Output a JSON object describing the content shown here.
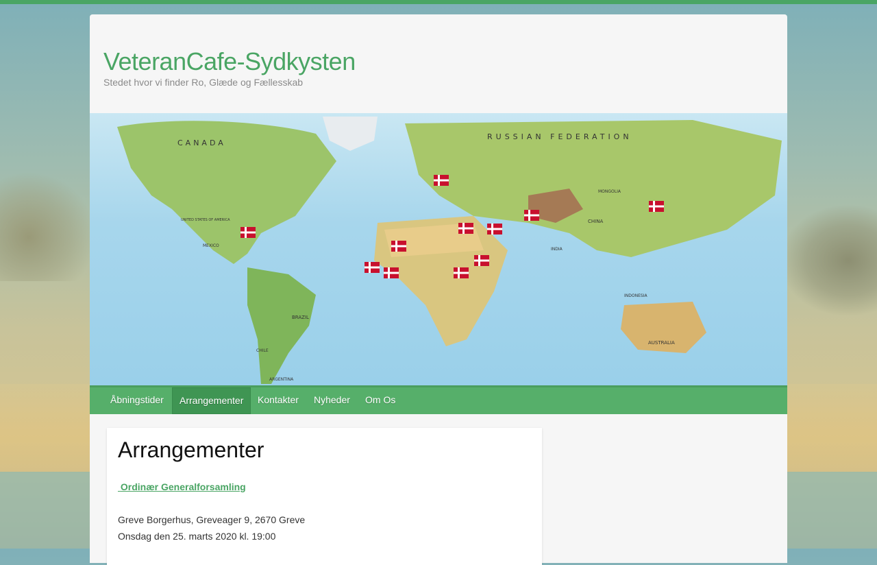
{
  "site": {
    "title": "VeteranCafe-Sydkysten",
    "tagline": "Stedet hvor vi finder Ro, Glæde og Fællesskab"
  },
  "banner": {
    "map_labels": [
      "CANADA",
      "RUSSIAN FEDERATION",
      "BRAZIL",
      "AUSTRALIA",
      "CHINA",
      "MEXICO",
      "UNITED STATES OF AMERICA",
      "CHILE",
      "ARGENTINA",
      "INDONESIA",
      "MONGOLIA",
      "INDIA"
    ],
    "flag_color": "#c8102e"
  },
  "nav": {
    "items": [
      {
        "label": "Åbningstider"
      },
      {
        "label": "Arrangementer"
      },
      {
        "label": "Kontakter"
      },
      {
        "label": "Nyheder"
      },
      {
        "label": "Om Os"
      }
    ],
    "active": "Arrangementer"
  },
  "page": {
    "heading": "Arrangementer",
    "event_title": "Ordinær Generalforsamling",
    "event_location": "Greve Borgerhus, Greveager 9, 2670 Greve",
    "event_date": "Onsdag den 25. marts 2020 kl. 19:00"
  },
  "colors": {
    "accent": "#4aa564",
    "nav_bg": "#56af6a",
    "nav_active": "#3f9553"
  }
}
